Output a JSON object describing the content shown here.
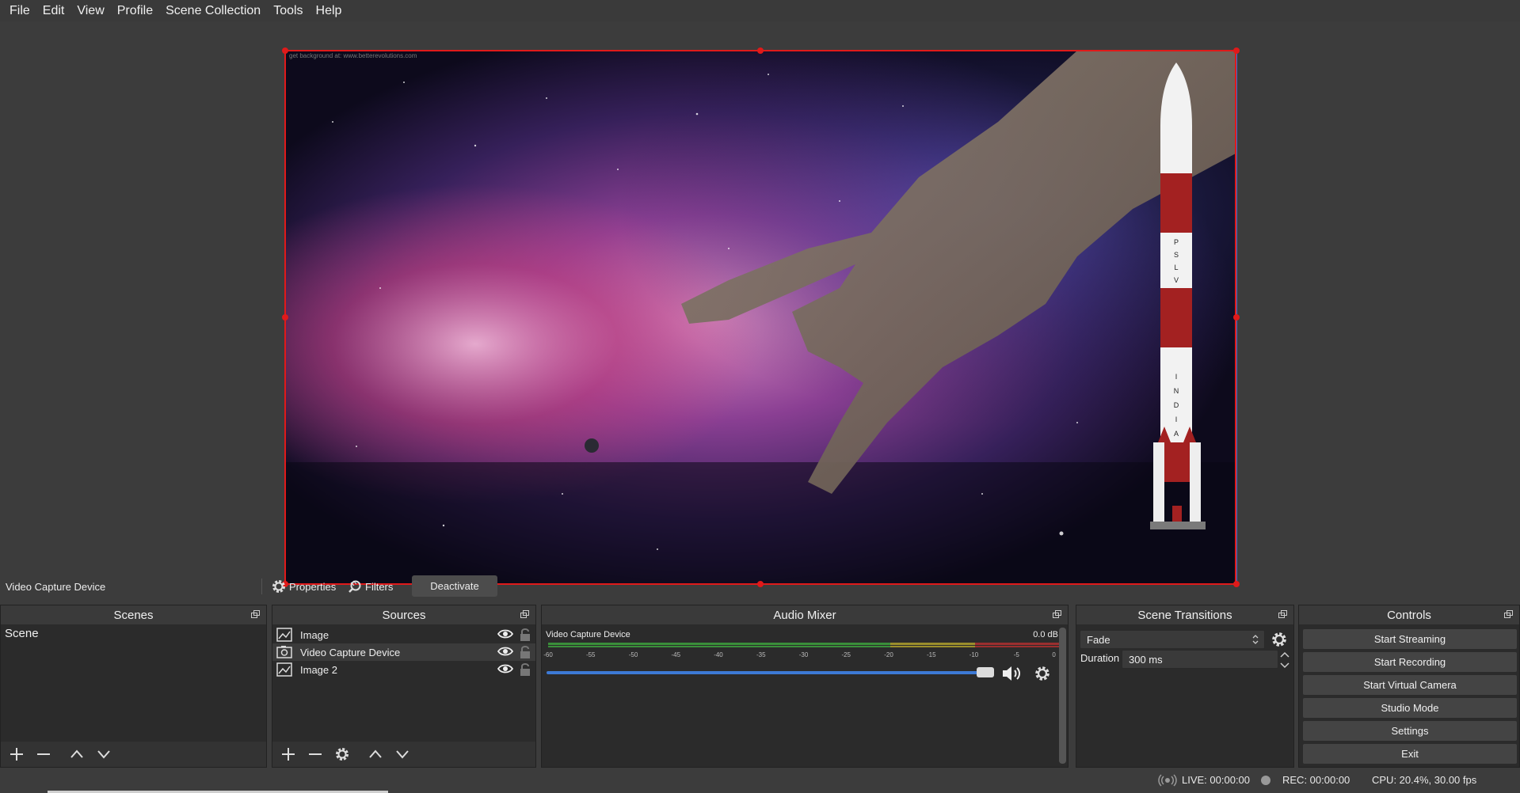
{
  "menu": [
    "File",
    "Edit",
    "View",
    "Profile",
    "Scene Collection",
    "Tools",
    "Help"
  ],
  "preview": {
    "credit_text": "get background at: www.betterevolutions.com",
    "rocket_top_text": [
      "P",
      "S",
      "L",
      "V"
    ],
    "rocket_bottom_text": [
      "I",
      "N",
      "D",
      "I",
      "A"
    ]
  },
  "context": {
    "source_name": "Video Capture Device",
    "properties_label": "Properties",
    "filters_label": "Filters",
    "deactivate_label": "Deactivate"
  },
  "scenes": {
    "title": "Scenes",
    "items": [
      "Scene"
    ]
  },
  "sources": {
    "title": "Sources",
    "items": [
      {
        "name": "Image",
        "type": "image-icon"
      },
      {
        "name": "Video Capture Device",
        "type": "camera-icon"
      },
      {
        "name": "Image 2",
        "type": "image-icon"
      }
    ]
  },
  "mixer": {
    "title": "Audio Mixer",
    "channel_name": "Video Capture Device",
    "level": "0.0 dB",
    "ticks": [
      "-60",
      "-55",
      "-50",
      "-45",
      "-40",
      "-35",
      "-30",
      "-25",
      "-20",
      "-15",
      "-10",
      "-5",
      "0"
    ],
    "volume": 1.0
  },
  "transitions": {
    "title": "Scene Transitions",
    "selected": "Fade",
    "duration_label": "Duration",
    "duration_value": "300 ms"
  },
  "controls": {
    "title": "Controls",
    "buttons": [
      "Start Streaming",
      "Start Recording",
      "Start Virtual Camera",
      "Studio Mode",
      "Settings",
      "Exit"
    ]
  },
  "status": {
    "live": "LIVE: 00:00:00",
    "rec": "REC: 00:00:00",
    "cpu": "CPU: 20.4%, 30.00 fps"
  },
  "colors": {
    "selection": "#e01a1a",
    "volume_slider": "#3d7ad6",
    "meter_green": "#3a8f3a",
    "meter_yellow": "#9a8d2c",
    "meter_red": "#9a2f2f"
  }
}
